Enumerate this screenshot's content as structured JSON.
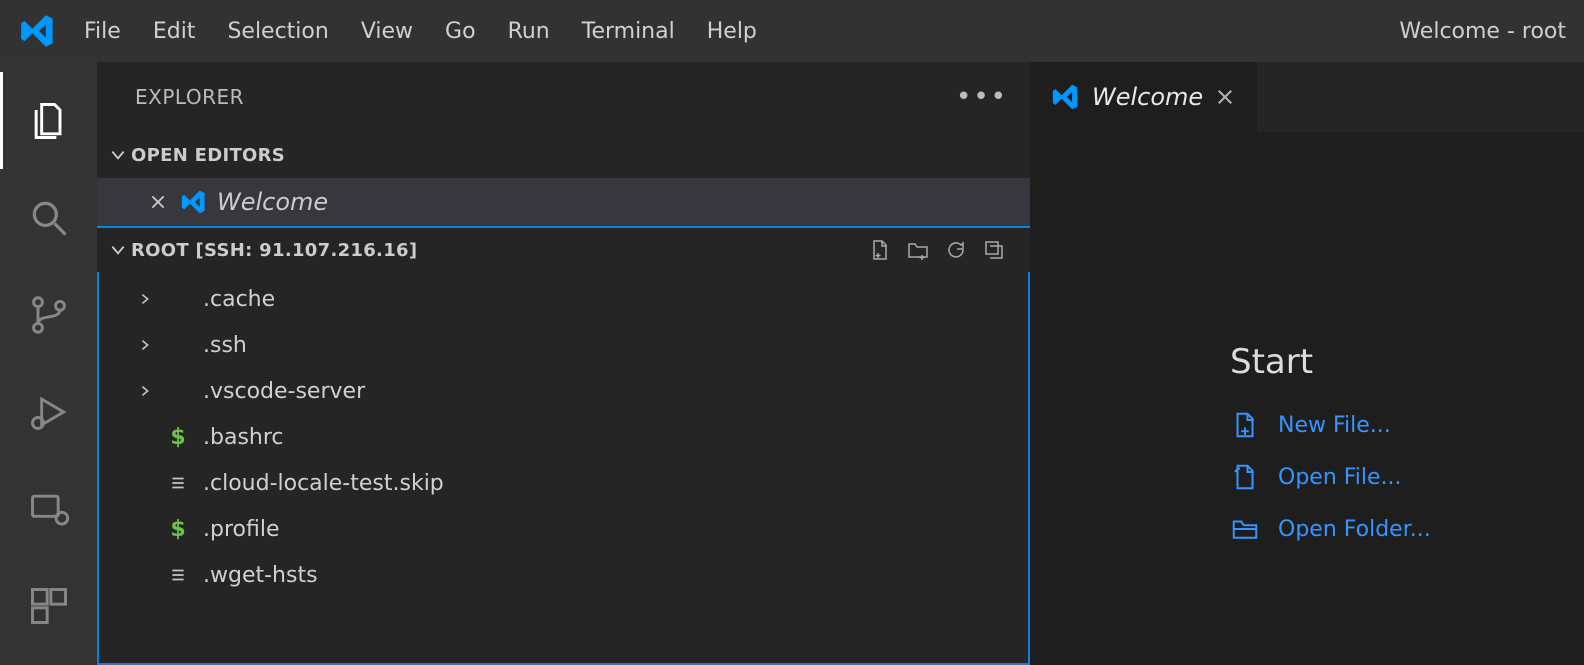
{
  "menubar": {
    "items": [
      "File",
      "Edit",
      "Selection",
      "View",
      "Go",
      "Run",
      "Terminal",
      "Help"
    ]
  },
  "window_title": "Welcome - root",
  "sidebar": {
    "title": "EXPLORER",
    "open_editors_label": "OPEN EDITORS",
    "open_editor_item": "Welcome",
    "workspace_label": "ROOT [SSH: 91.107.216.16]",
    "tree": [
      {
        "kind": "dir",
        "name": ".cache"
      },
      {
        "kind": "dir",
        "name": ".ssh"
      },
      {
        "kind": "dir",
        "name": ".vscode-server"
      },
      {
        "kind": "sh",
        "name": ".bashrc"
      },
      {
        "kind": "file",
        "name": ".cloud-locale-test.skip"
      },
      {
        "kind": "sh",
        "name": ".profile"
      },
      {
        "kind": "file",
        "name": ".wget-hsts"
      }
    ]
  },
  "tab": {
    "label": "Welcome"
  },
  "welcome": {
    "heading": "Start",
    "links": [
      {
        "icon": "new-file",
        "label": "New File..."
      },
      {
        "icon": "open-file",
        "label": "Open File..."
      },
      {
        "icon": "open-folder",
        "label": "Open Folder..."
      }
    ]
  }
}
